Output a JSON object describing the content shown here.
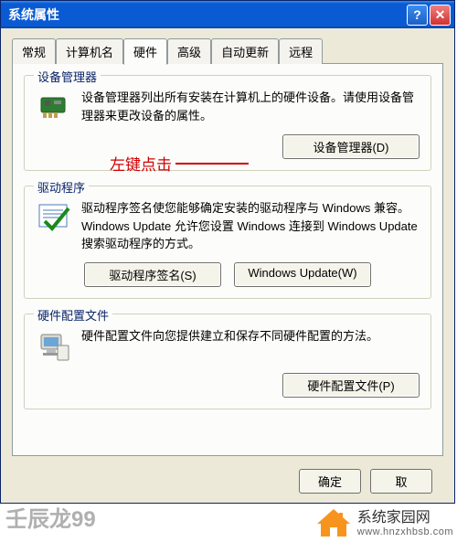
{
  "window": {
    "title": "系统属性"
  },
  "tabs": [
    "常规",
    "计算机名",
    "硬件",
    "高级",
    "自动更新",
    "远程"
  ],
  "active_tab_index": 2,
  "groups": {
    "devmgr": {
      "title": "设备管理器",
      "desc": "设备管理器列出所有安装在计算机上的硬件设备。请使用设备管理器来更改设备的属性。",
      "button": "设备管理器(D)"
    },
    "driver": {
      "title": "驱动程序",
      "desc": "驱动程序签名使您能够确定安装的驱动程序与 Windows 兼容。Windows Update 允许您设置 Windows 连接到 Windows Update 搜索驱动程序的方式。",
      "button_sign": "驱动程序签名(S)",
      "button_wu": "Windows Update(W)"
    },
    "hwprofile": {
      "title": "硬件配置文件",
      "desc": "硬件配置文件向您提供建立和保存不同硬件配置的方法。",
      "button": "硬件配置文件(P)"
    }
  },
  "annotation": "左键点击",
  "dialog_buttons": {
    "ok": "确定",
    "cancel": "取"
  },
  "watermark": {
    "left": "壬辰龙99",
    "right_title": "系统家园网",
    "right_url": "www.hnzxhbsb.com"
  }
}
